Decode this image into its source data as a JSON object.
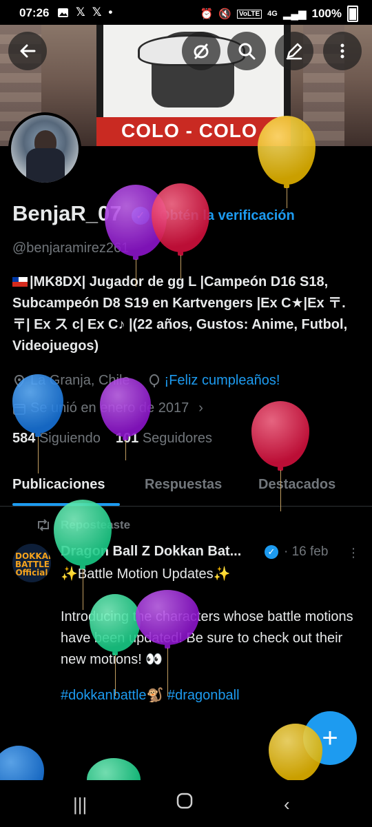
{
  "status_bar": {
    "time": "07:26",
    "left_icons": [
      "image-icon",
      "x-icon",
      "x-icon",
      "dot-icon"
    ],
    "battery": "100%",
    "network": "4G"
  },
  "header": {
    "banner_text": "COLO - COLO",
    "buttons": [
      "back-arrow-icon",
      "hide-icon",
      "search-icon",
      "edit-icon",
      "more-icon"
    ]
  },
  "profile": {
    "name": "BenjaR_07",
    "get_verified": "Obtén la verificación",
    "handle": "@benjaramirez261",
    "bio": "|MK8DX| Jugador de gg L |Campeón D16 S18, Subcampeón D8 S19 en Kartvengers |Ex C★|Ex 〒.〒| Ex ス c| Ex C♪ |(22 años, Gustos: Anime, Futbol, Videojuegos)",
    "location": "La Granja, Chile",
    "birthday": "¡Feliz cumpleaños!",
    "joined": "Se unió en enero de 2017",
    "following_count": "584",
    "following_label": "Siguiendo",
    "followers_count": "101",
    "followers_label": "Seguidores"
  },
  "tabs": [
    {
      "label": "Publicaciones",
      "active": true
    },
    {
      "label": "Respuestas",
      "active": false
    },
    {
      "label": "Destacados",
      "active": false
    }
  ],
  "post": {
    "repost_label": "Reposteaste",
    "avatar_text": "DOKKAN BATTLE Official",
    "author": "Dragon Ball Z Dokkan Bat...",
    "date": "· 16 feb",
    "text": "✨Battle Motion Updates✨\n\nIntroducing the characters whose battle motions have been updated! Be sure to check out their new motions! 👀",
    "hashtags": "#dokkanbattle🐒 #dragonball"
  },
  "fab": {
    "icon": "plus-icon"
  },
  "colors": {
    "accent": "#1d9bf0",
    "background": "#000000",
    "muted": "#71767b",
    "balloon_colors": [
      "#f5c518",
      "#a020f0",
      "#e8174a",
      "#1e88e5",
      "#2ee59d"
    ]
  }
}
